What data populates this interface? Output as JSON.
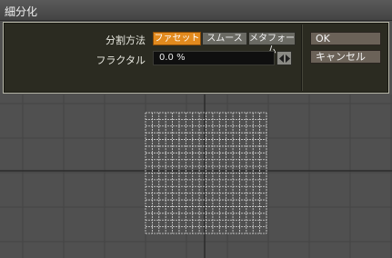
{
  "window": {
    "title": "細分化"
  },
  "form": {
    "method_label": "分割方法",
    "methods": [
      {
        "label": "ファセット",
        "selected": true
      },
      {
        "label": "スムース",
        "selected": false
      },
      {
        "label": "メタフォーム",
        "selected": false
      }
    ],
    "fractal_label": "フラクタル",
    "fractal_value": "0.0 %"
  },
  "buttons": {
    "ok": "OK",
    "cancel": "キャンセル"
  },
  "colors": {
    "selected_accent": "#e28a1e",
    "panel_bg": "#2b2b21",
    "viewport_bg": "#505050"
  },
  "icons": {
    "stepper": "left-right-arrows-icon"
  }
}
